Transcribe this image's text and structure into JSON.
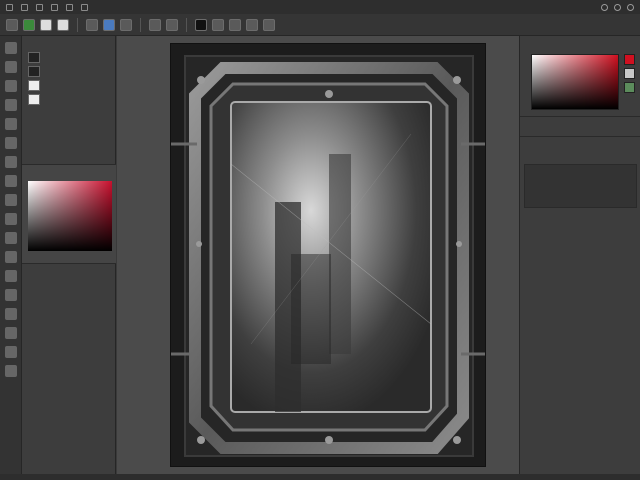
{
  "left_panel": {
    "title": "",
    "layers": [
      {
        "label": "",
        "thumb": "dark-image"
      },
      {
        "label": "",
        "thumb": "dark-image"
      },
      {
        "label": "",
        "thumb": "white"
      },
      {
        "label": "",
        "thumb": "brush"
      }
    ],
    "color_title": "",
    "hex": ""
  },
  "right_panel": {
    "row1": "",
    "row2": "",
    "row3": ""
  },
  "swatch_colors": [
    "#d01020",
    "#c8c8c8",
    "#5c8c5c"
  ],
  "accent": "#c8102e"
}
